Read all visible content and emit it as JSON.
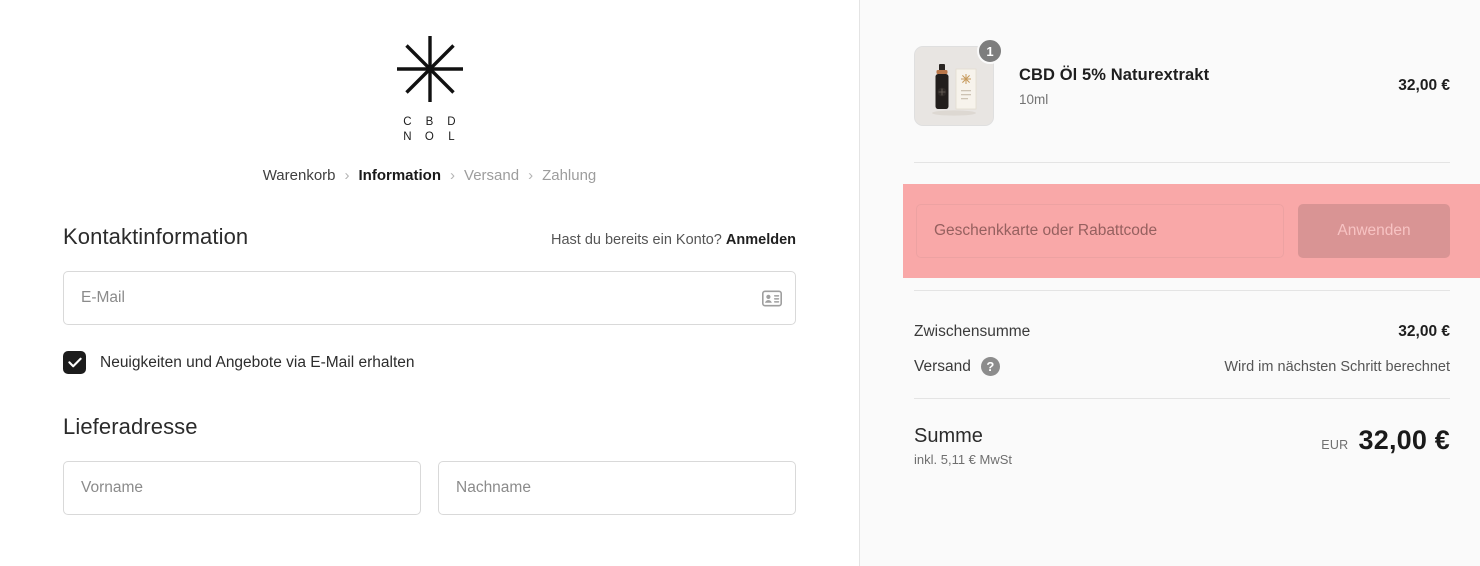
{
  "brand": {
    "logo_icon": "asterisk-star-icon",
    "wordmark_rows": [
      [
        "C",
        "B",
        "D"
      ],
      [
        "N",
        "O",
        "L"
      ]
    ]
  },
  "breadcrumb": {
    "separator": "›",
    "items": [
      {
        "label": "Warenkorb",
        "state": "done"
      },
      {
        "label": "Information",
        "state": "current"
      },
      {
        "label": "Versand",
        "state": "future"
      },
      {
        "label": "Zahlung",
        "state": "future"
      }
    ]
  },
  "contact": {
    "title": "Kontaktinformation",
    "account_prompt": "Hast du bereits ein Konto?",
    "login_link": "Anmelden",
    "email": {
      "value": "",
      "placeholder": "E-Mail",
      "icon": "contact-card-icon"
    },
    "newsletter": {
      "label": "Neuigkeiten und Angebote via E-Mail erhalten",
      "checked": true
    }
  },
  "shipping_address": {
    "title": "Lieferadresse",
    "first_name": {
      "value": "",
      "placeholder": "Vorname"
    },
    "last_name": {
      "value": "",
      "placeholder": "Nachname"
    }
  },
  "summary": {
    "line_items": [
      {
        "title": "CBD Öl 5% Naturextrakt",
        "variant": "10ml",
        "quantity": "1",
        "price": "32,00 €",
        "thumbnail": "cbd-oil-bottle-and-box-image"
      }
    ],
    "discount": {
      "input": {
        "value": "",
        "placeholder": "Geschenkkarte oder Rabattcode"
      },
      "apply_label": "Anwenden",
      "highlight_color": "#f9a8a8",
      "button_color": "#d99494"
    },
    "subtotal": {
      "label": "Zwischensumme",
      "value": "32,00 €"
    },
    "shipping": {
      "label": "Versand",
      "help_icon": "question-mark-icon",
      "help_glyph": "?",
      "value": "Wird im nächsten Schritt berechnet"
    },
    "total": {
      "label": "Summe",
      "tax_note": "inkl. 5,11 € MwSt",
      "currency": "EUR",
      "amount": "32,00 €"
    }
  }
}
